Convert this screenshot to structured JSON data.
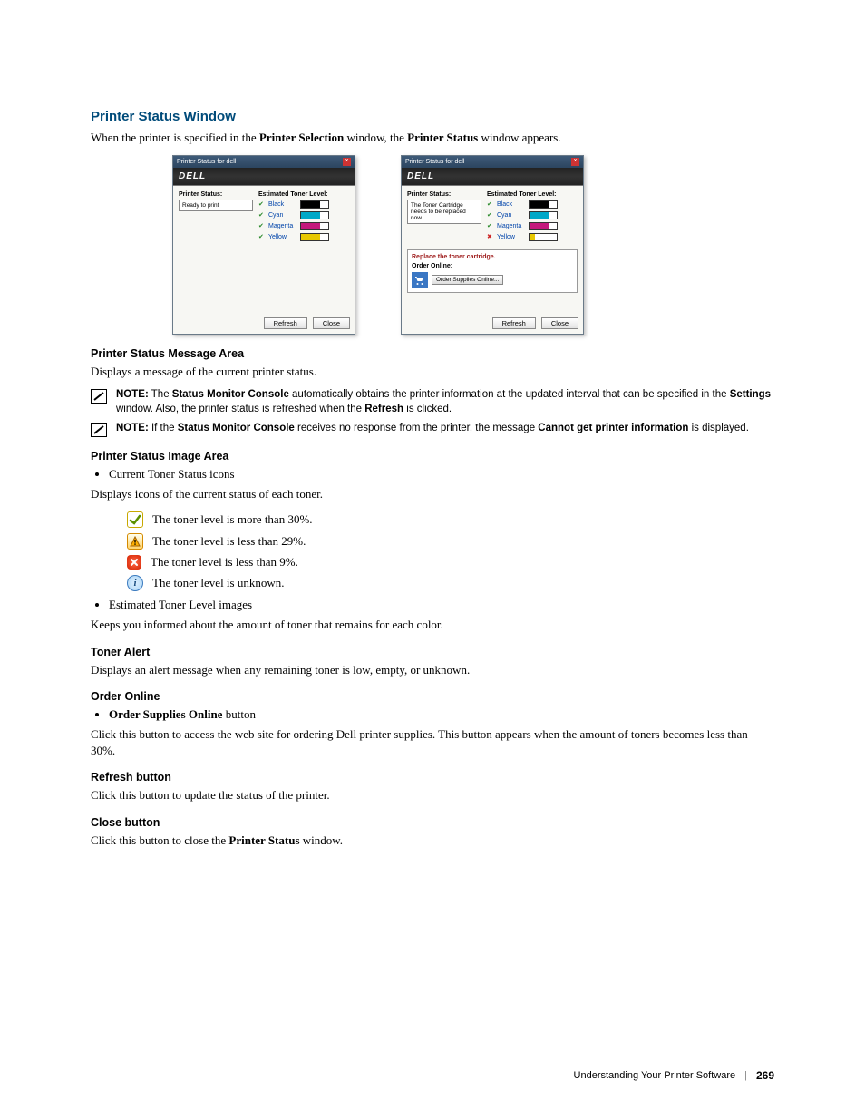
{
  "section_title": "Printer Status Window",
  "intro_pre": "When the printer is specified in the ",
  "intro_b1": "Printer Selection",
  "intro_mid": " window, the ",
  "intro_b2": "Printer Status",
  "intro_post": " window appears.",
  "shot_title": "Printer Status for dell",
  "shot_brand": "DELL",
  "shot_status_label": "Printer Status:",
  "shot_toner_label": "Estimated Toner Level:",
  "shot1_status": "Ready to print",
  "shot2_status": "The Toner Cartridge needs to be replaced now.",
  "toner_black": "Black",
  "toner_cyan": "Cyan",
  "toner_magenta": "Magenta",
  "toner_yellow": "Yellow",
  "alert_title": "Replace the toner cartridge.",
  "order_online_lbl": "Order Online:",
  "order_supplies_btn": "Order Supplies Online...",
  "btn_refresh": "Refresh",
  "btn_close": "Close",
  "h_msg_area": "Printer Status Message Area",
  "p_msg_area": "Displays a message of the current printer status.",
  "note1_pre": " The ",
  "note1_b1": "Status Monitor Console",
  "note1_mid1": " automatically obtains the printer information at the updated interval that can be specified in the ",
  "note1_b2": "Settings",
  "note1_mid2": " window. Also, the printer status is refreshed when the ",
  "note1_b3": "Refresh",
  "note1_post": " is clicked.",
  "note_label": "NOTE:",
  "note2_pre": " If the ",
  "note2_b1": "Status Monitor Console",
  "note2_mid": " receives no response from the printer, the message ",
  "note2_b2": "Cannot get printer information",
  "note2_post": " is displayed.",
  "h_img_area": "Printer Status Image Area",
  "li_current": "Current Toner Status icons",
  "p_current": "Displays icons of the current status of each toner.",
  "lvl_more30": "The toner level is more than 30%.",
  "lvl_less29": "The toner level is less than 29%.",
  "lvl_less9": "The toner level is less than 9%.",
  "lvl_unknown": "The toner level is unknown.",
  "li_est": "Estimated Toner Level images",
  "p_est": "Keeps you informed about the amount of toner that remains for each color.",
  "h_toner_alert": "Toner Alert",
  "p_toner_alert": "Displays an alert message when any remaining toner is low, empty, or unknown.",
  "h_order": "Order Online",
  "li_order_b": "Order Supplies Online",
  "li_order_post": " button",
  "p_order": "Click this button to access the web site for ordering Dell printer supplies. This button appears when the amount of toners becomes less than 30%.",
  "h_refresh": "Refresh button",
  "p_refresh": "Click this button to update the status of the printer.",
  "h_close": "Close button",
  "p_close_pre": "Click this button to close the ",
  "p_close_b": "Printer Status",
  "p_close_post": " window.",
  "footer_text": "Understanding Your Printer Software",
  "footer_page": "269"
}
